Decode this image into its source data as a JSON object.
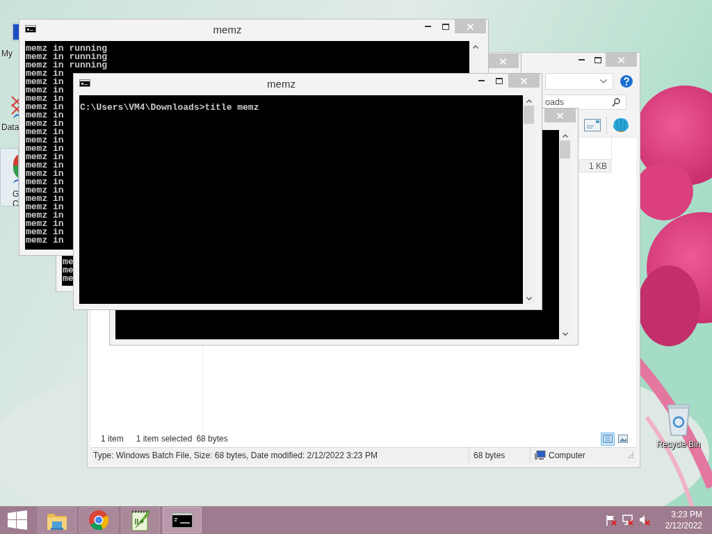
{
  "desktop_icons": [
    {
      "kind": "computer",
      "label_lines": [
        "My"
      ],
      "selected": false
    },
    {
      "kind": "broken-shortcut",
      "label_lines": [
        "Data"
      ],
      "selected": false
    },
    {
      "kind": "browser",
      "label_lines": [
        "G",
        "C"
      ],
      "selected": true
    },
    {
      "kind": "recycle-bin",
      "label_lines": [
        "Recycle Bin"
      ],
      "selected": false
    }
  ],
  "explorer": {
    "search": {
      "value": "oads"
    },
    "file_size": "1 KB",
    "item_count": "1 item",
    "selection_info": "1 item selected",
    "selection_size": "68 bytes",
    "view_buttons": [
      {
        "kind": "details",
        "selected": true
      },
      {
        "kind": "large-icons",
        "selected": false
      }
    ],
    "status_bar": {
      "details": "Type: Windows Batch File, Size: 68 bytes, Date modified: 2/12/2022 3:23 PM",
      "size": "68 bytes",
      "location": "Computer"
    }
  },
  "consoles": [
    {
      "title": "memz",
      "lines": [
        "memz in running",
        "memz in running",
        "memz in running",
        "memz in",
        "memz in",
        "memz in",
        "memz in",
        "memz in",
        "memz in",
        "memz in",
        "memz in",
        "memz in",
        "memz in",
        "memz in",
        "memz in",
        "memz in",
        "memz in",
        "memz in",
        "memz in",
        "memz in",
        "memz in",
        "memz in",
        "memz in",
        "memz in"
      ]
    },
    {
      "lines": [
        "me",
        "me",
        "me"
      ]
    },
    {
      "title": "memz",
      "lines": [
        "C:\\Users\\VM4\\Downloads>title memz"
      ]
    }
  ],
  "taskbar": {
    "apps": [
      {
        "kind": "explorer",
        "active": false
      },
      {
        "kind": "browser",
        "active": false
      },
      {
        "kind": "notepad",
        "active": false
      },
      {
        "kind": "console",
        "active": true
      }
    ],
    "clock": {
      "time": "3:23 PM",
      "date": "2/12/2022"
    }
  }
}
